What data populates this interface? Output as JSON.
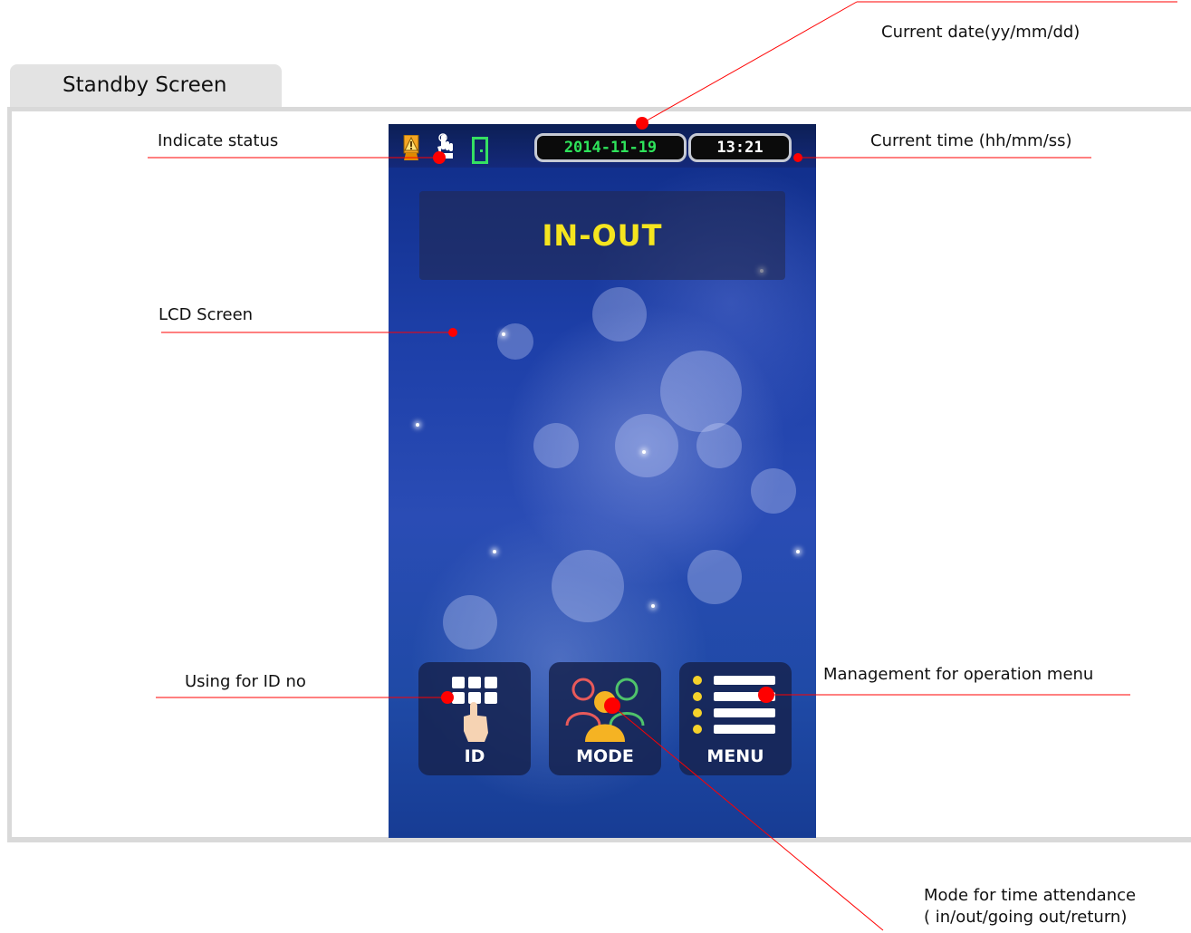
{
  "tab": {
    "label": "Standby Screen"
  },
  "device": {
    "status": {
      "date": "2014-11-19",
      "time": "13:21"
    },
    "mode_banner": "IN-OUT",
    "buttons": {
      "id": "ID",
      "mode": "MODE",
      "menu": "MENU"
    }
  },
  "callouts": {
    "date": "Current date(yy/mm/dd)",
    "status": "Indicate status",
    "time": "Current time (hh/mm/ss)",
    "lcd": "LCD Screen",
    "id": "Using for ID no",
    "menu": "Management for operation menu",
    "mode_line1": "Mode for time attendance",
    "mode_line2": "( in/out/going out/return)"
  },
  "colors": {
    "annotation": "#ff0000",
    "date_text": "#2ee35a",
    "banner_text": "#f5e51f",
    "screen_bg": "#1d3fa8"
  },
  "icons": [
    "warning-icon",
    "touch-icon",
    "door-icon",
    "keypad-icon",
    "users-icon",
    "menu-list-icon"
  ]
}
